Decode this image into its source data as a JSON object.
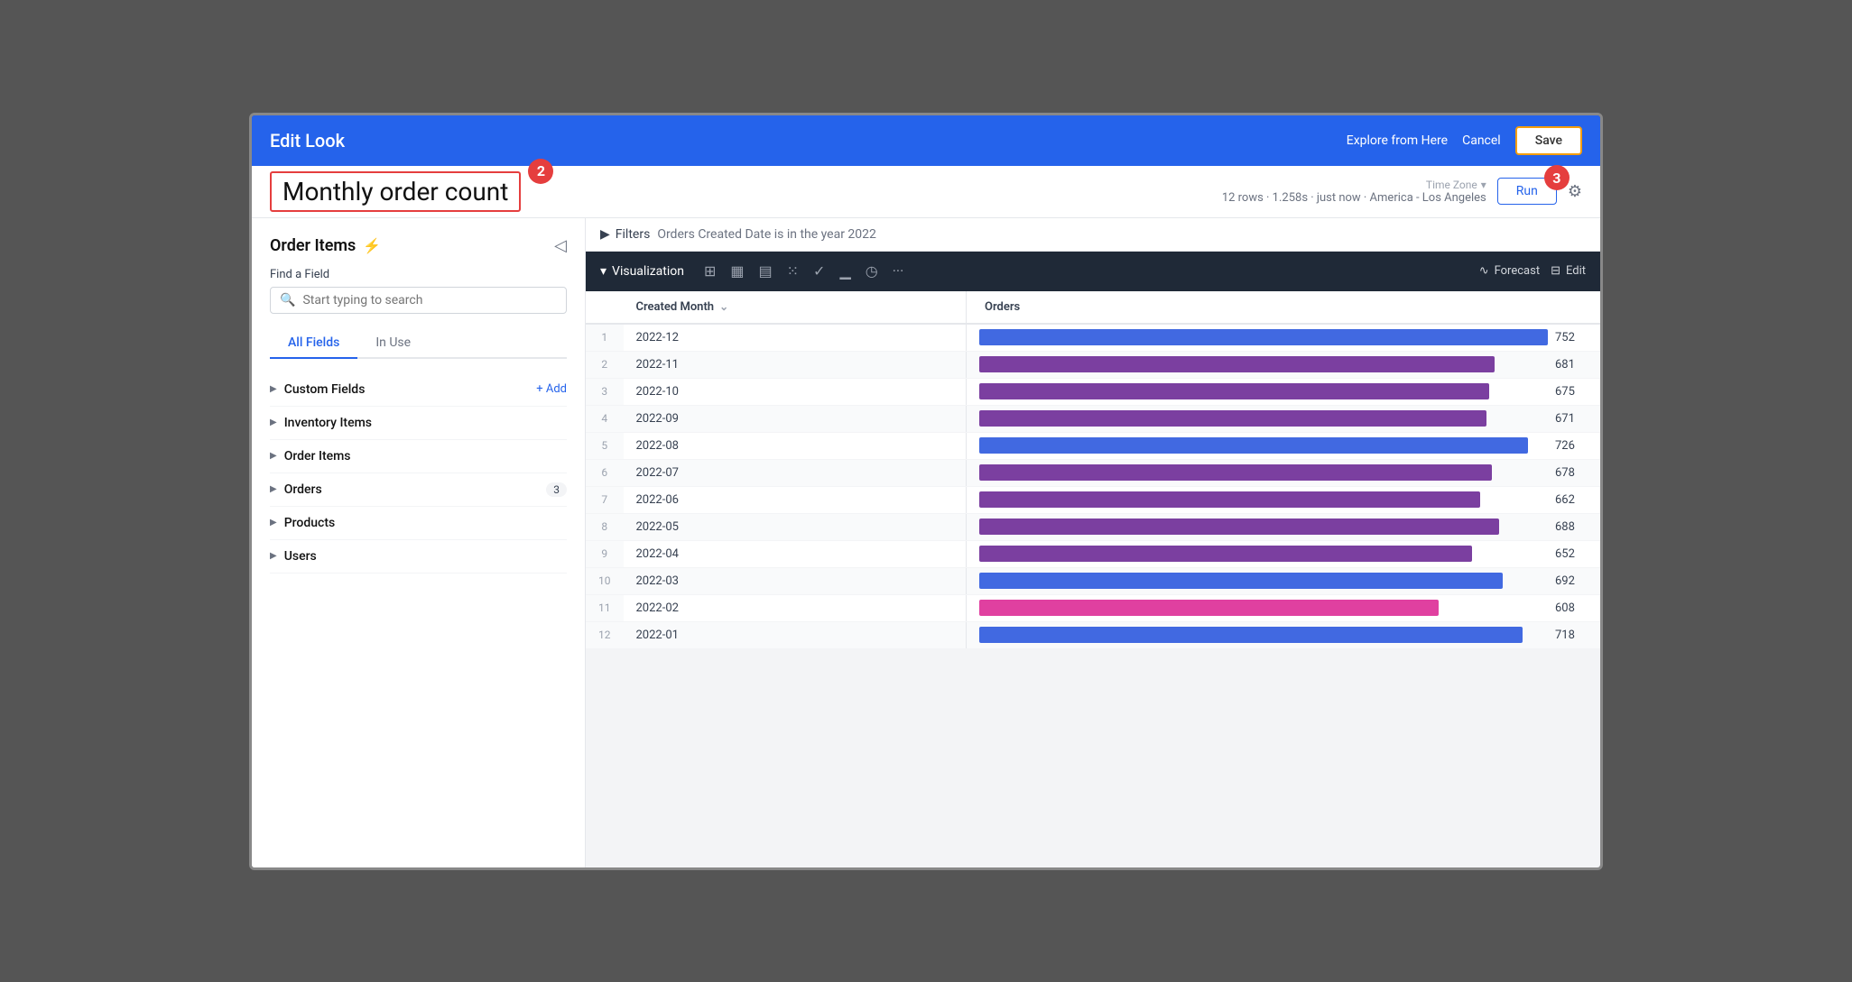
{
  "header": {
    "title": "Edit Look",
    "explore_label": "Explore from Here",
    "cancel_label": "Cancel",
    "save_label": "Save"
  },
  "subheader": {
    "look_title": "Monthly order count",
    "meta": "12 rows · 1.258s · just now · America - Los Angeles",
    "timezone_label": "Time Zone",
    "run_label": "Run",
    "badge2": "2",
    "badge3": "3"
  },
  "sidebar": {
    "title": "Order Items",
    "find_field_label": "Find a Field",
    "search_placeholder": "Start typing to search",
    "tab_all_fields": "All Fields",
    "tab_in_use": "In Use",
    "groups": [
      {
        "label": "Custom Fields",
        "add": true,
        "badge": null
      },
      {
        "label": "Inventory Items",
        "add": false,
        "badge": null
      },
      {
        "label": "Order Items",
        "add": false,
        "badge": null
      },
      {
        "label": "Orders",
        "add": false,
        "badge": "3"
      },
      {
        "label": "Products",
        "add": false,
        "badge": null
      },
      {
        "label": "Users",
        "add": false,
        "badge": null
      }
    ]
  },
  "filters": {
    "label": "Filters",
    "text": "Orders Created Date is in the year 2022"
  },
  "viz_bar": {
    "label": "Visualization",
    "forecast_label": "Forecast",
    "edit_label": "Edit"
  },
  "table": {
    "col_num": "#",
    "col_created": "Created Month",
    "col_orders": "Orders",
    "rows": [
      {
        "num": 1,
        "month": "2022-12",
        "orders": 752,
        "color": "#4169e1"
      },
      {
        "num": 2,
        "month": "2022-11",
        "orders": 681,
        "color": "#7b3fa0"
      },
      {
        "num": 3,
        "month": "2022-10",
        "orders": 675,
        "color": "#7b3fa0"
      },
      {
        "num": 4,
        "month": "2022-09",
        "orders": 671,
        "color": "#7b3fa0"
      },
      {
        "num": 5,
        "month": "2022-08",
        "orders": 726,
        "color": "#4169e1"
      },
      {
        "num": 6,
        "month": "2022-07",
        "orders": 678,
        "color": "#7b3fa0"
      },
      {
        "num": 7,
        "month": "2022-06",
        "orders": 662,
        "color": "#7b3fa0"
      },
      {
        "num": 8,
        "month": "2022-05",
        "orders": 688,
        "color": "#7b3fa0"
      },
      {
        "num": 9,
        "month": "2022-04",
        "orders": 652,
        "color": "#7b3fa0"
      },
      {
        "num": 10,
        "month": "2022-03",
        "orders": 692,
        "color": "#4169e1"
      },
      {
        "num": 11,
        "month": "2022-02",
        "orders": 608,
        "color": "#e040a0"
      },
      {
        "num": 12,
        "month": "2022-01",
        "orders": 718,
        "color": "#4169e1"
      }
    ],
    "max_orders": 752
  }
}
